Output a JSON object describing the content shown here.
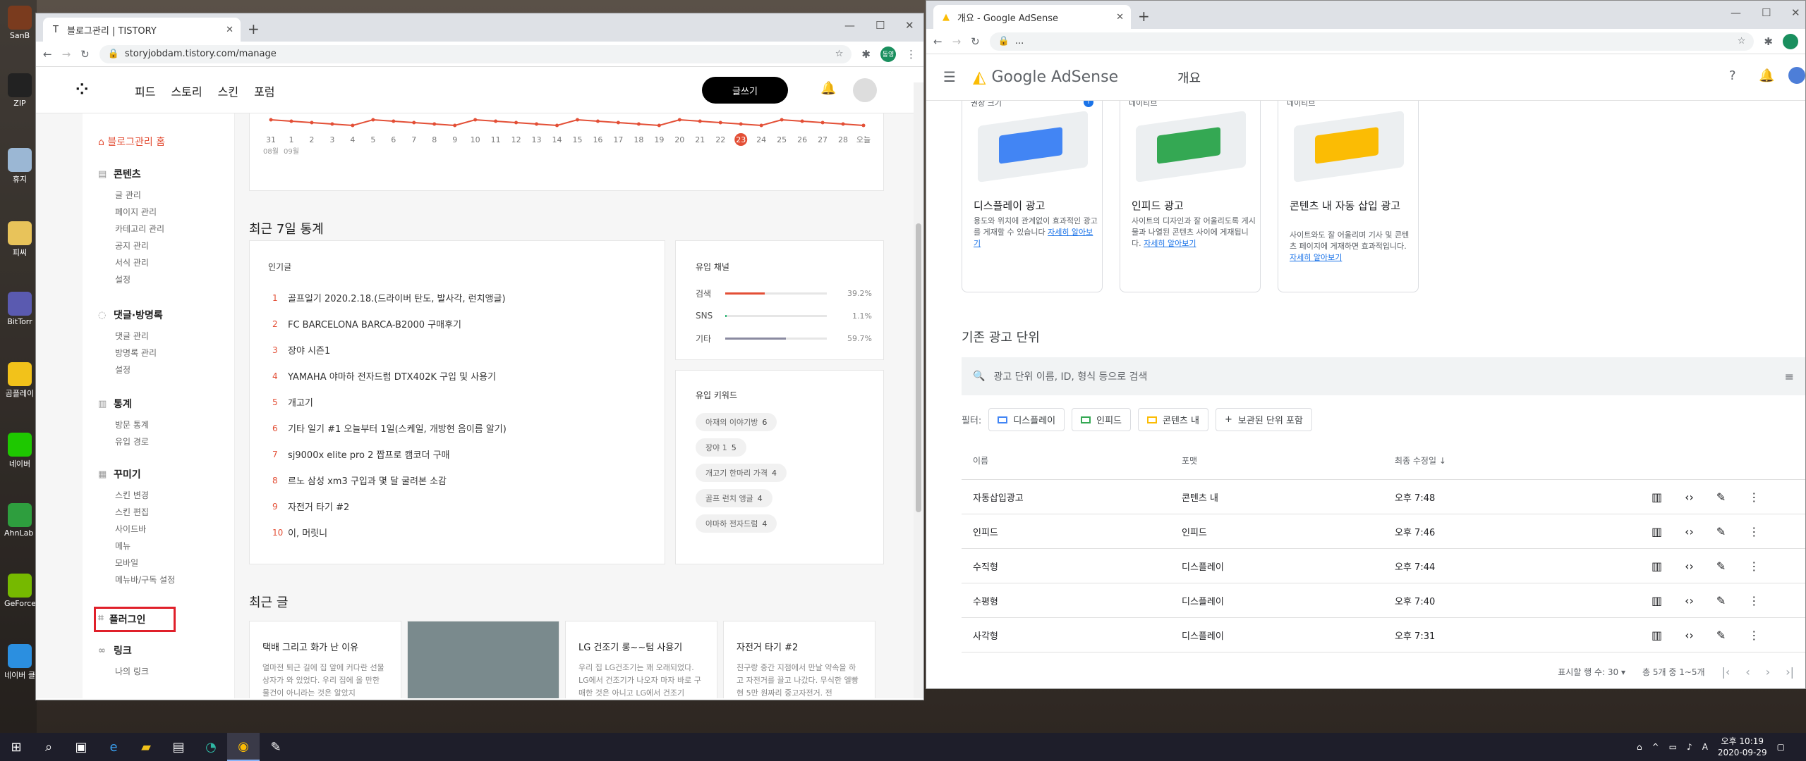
{
  "desktop": {
    "icons": [
      {
        "label": "SanB"
      },
      {
        "label": "ZIP"
      },
      {
        "label": "휴지"
      },
      {
        "label": "피씨"
      },
      {
        "label": "BitTorr"
      },
      {
        "label": "곰플레이"
      },
      {
        "label": "네이버"
      },
      {
        "label": "AhnLab Lite"
      },
      {
        "label": "GeForce Experience"
      },
      {
        "label": "네이버 클라우"
      }
    ]
  },
  "tistory_window": {
    "tab_title": "블로그관리 | TISTORY",
    "url": "storyjobdam.tistory.com/manage",
    "profile_badge": "동영",
    "nav": [
      "피드",
      "스토리",
      "스킨",
      "포럼"
    ],
    "write_button": "글쓰기",
    "sidebar": {
      "home": "블로그관리 홈",
      "sections": [
        {
          "title": "콘텐츠",
          "items": [
            "글 관리",
            "페이지 관리",
            "카테고리 관리",
            "공지 관리",
            "서식 관리",
            "설정"
          ]
        },
        {
          "title": "댓글·방명록",
          "items": [
            "댓글 관리",
            "방명록 관리",
            "설정"
          ]
        },
        {
          "title": "통계",
          "items": [
            "방문 통계",
            "유입 경로"
          ]
        },
        {
          "title": "꾸미기",
          "items": [
            "스킨 변경",
            "스킨 편집",
            "사이드바",
            "메뉴",
            "모바일",
            "메뉴바/구독 설정"
          ]
        }
      ],
      "plugin": "플러그인",
      "link_section": {
        "title": "링크",
        "items": [
          "나의 링크"
        ]
      }
    },
    "chart": {
      "x_labels": [
        "31",
        "1",
        "2",
        "3",
        "4",
        "5",
        "6",
        "7",
        "8",
        "9",
        "10",
        "11",
        "12",
        "13",
        "14",
        "15",
        "16",
        "17",
        "18",
        "19",
        "20",
        "21",
        "22",
        "23",
        "24",
        "25",
        "26",
        "27",
        "28",
        "오늘"
      ],
      "month_labels": [
        "08월",
        "09월"
      ],
      "highlight": "23"
    },
    "stats_title": "최근 7일 통계",
    "popular": {
      "title": "인기글",
      "items": [
        "골프일기 2020.2.18.(드라이버 탄도, 발사각, 런치앵글)",
        "FC BARCELONA BARCA-B2000 구매후기",
        "장야 시즌1",
        "YAMAHA 야마하 전자드럼 DTX402K 구입 및 사용기",
        "개고기",
        "기타 일기 #1 오늘부터 1일(스케일, 개방현 음이름 알기)",
        "sj9000x elite pro 2 짭프로 캠코더 구매",
        "르노 삼성 xm3 구입과 몇 달 굴려본 소감",
        "자전거 타기 #2",
        "이, 머릿니"
      ]
    },
    "inflow": {
      "title": "유입 채널",
      "rows": [
        {
          "label": "검색",
          "pct": "39.2%",
          "value": 39.2,
          "color": "#e34f36"
        },
        {
          "label": "SNS",
          "pct": "1.1%",
          "value": 1.1,
          "color": "#2bb673"
        },
        {
          "label": "기타",
          "pct": "59.7%",
          "value": 59.7,
          "color": "#8a8aa0"
        }
      ]
    },
    "keywords": {
      "title": "유입 키워드",
      "items": [
        {
          "label": "아재의 이야기방",
          "count": "6"
        },
        {
          "label": "장야 1",
          "count": "5"
        },
        {
          "label": "개고기 한마리 가격",
          "count": "4"
        },
        {
          "label": "골프 런치 앵글",
          "count": "4"
        },
        {
          "label": "야마하 전자드럼",
          "count": "4"
        }
      ]
    },
    "recent_title": "최근 글",
    "recent_posts": [
      {
        "title": "택배 그리고 화가 난 이유",
        "desc": "얼마전 퇴근 길에 집 앞에 커다란 선물 상자가 와 있었다. 우리 집에 올 만한 물건이 아니라는 것은 알았지"
      },
      {
        "title": "",
        "desc": ""
      },
      {
        "title": "LG 건조기 롱~~텀 사용기",
        "desc": "우리 집 LG건조기는 꽤 오래되었다. LG에서 건조기가 나오자 마자 바로 구매한 것은 아니고 LG에서 건조기"
      },
      {
        "title": "자전거 타기 #2",
        "desc": "친구랑 중간 지점에서 만날 약속을 하고 자전거를 끌고 나갔다. 무식한 엘빵현 5만 원짜리 중고자전거. 전"
      }
    ]
  },
  "adsense_window": {
    "tab_title": "개요 - Google AdSense",
    "url": "...",
    "profile_badge": "",
    "brand": "Google AdSense",
    "page_title": "개요",
    "ad_types": [
      {
        "badge": "권장 크기",
        "name": "디스플레이 광고",
        "desc": "용도와 위치에 관계없이 효과적인 광고를 게재할 수 있습니다",
        "link": "자세히 알아보기",
        "color": "#4285f4"
      },
      {
        "badge": "네이티브",
        "name": "인피드 광고",
        "desc": "사이트의 디자인과 잘 어울리도록 게시물과 나열된 콘텐츠 사이에 게재됩니다.",
        "link": "자세히 알아보기",
        "color": "#34a853"
      },
      {
        "badge": "네이티브",
        "name": "콘텐츠 내 자동 삽입 광고",
        "desc": "사이트와도 잘 어울리며 기사 및 콘텐츠 페이지에 게재하면 효과적입니다.",
        "link": "자세히 알아보기",
        "color": "#fbbc04"
      }
    ],
    "existing_title": "기존 광고 단위",
    "search_placeholder": "광고 단위 이름, ID, 형식 등으로 검색",
    "filter_label": "필터:",
    "filters": [
      {
        "label": "디스플레이",
        "color": "#4285f4"
      },
      {
        "label": "인피드",
        "color": "#34a853"
      },
      {
        "label": "콘텐츠 내",
        "color": "#fbbc04"
      }
    ],
    "archived_filter": "보관된 단위 포함",
    "columns": [
      "이름",
      "포맷",
      "최종 수정일"
    ],
    "rows": [
      {
        "name": "자동삽입광고",
        "format": "콘텐츠 내",
        "modified": "오후 7:48"
      },
      {
        "name": "인피드",
        "format": "인피드",
        "modified": "오후 7:46"
      },
      {
        "name": "수직형",
        "format": "디스플레이",
        "modified": "오후 7:44"
      },
      {
        "name": "수평형",
        "format": "디스플레이",
        "modified": "오후 7:40"
      },
      {
        "name": "사각형",
        "format": "디스플레이",
        "modified": "오후 7:31"
      }
    ],
    "rows_per_page_label": "표시할 행 수:",
    "rows_per_page": "30",
    "range": "총 5개 중 1~5개"
  },
  "taskbar": {
    "time": "오후 10:19",
    "date": "2020-09-29"
  }
}
